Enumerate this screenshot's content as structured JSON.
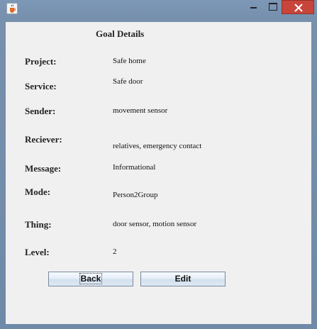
{
  "window": {
    "icon": "java-cup-icon",
    "controls": [
      "minimize-icon",
      "maximize-icon",
      "close-icon"
    ],
    "close_color": "#c7453b"
  },
  "form": {
    "heading": "Goal Details",
    "rows": [
      {
        "label": "Project:",
        "value": "Safe home"
      },
      {
        "label": "Service:",
        "value": "Safe door"
      },
      {
        "label": "Sender:",
        "value": "movement sensor"
      },
      {
        "label": "Reciever:",
        "value": "relatives, emergency contact"
      },
      {
        "label": "Message:",
        "value": "Informational"
      },
      {
        "label": "Mode:",
        "value": "Person2Group"
      },
      {
        "label": "Thing:",
        "value": "door sensor, motion sensor"
      },
      {
        "label": "Level:",
        "value": "2"
      }
    ]
  },
  "buttons": {
    "back": "Back",
    "edit": "Edit"
  }
}
